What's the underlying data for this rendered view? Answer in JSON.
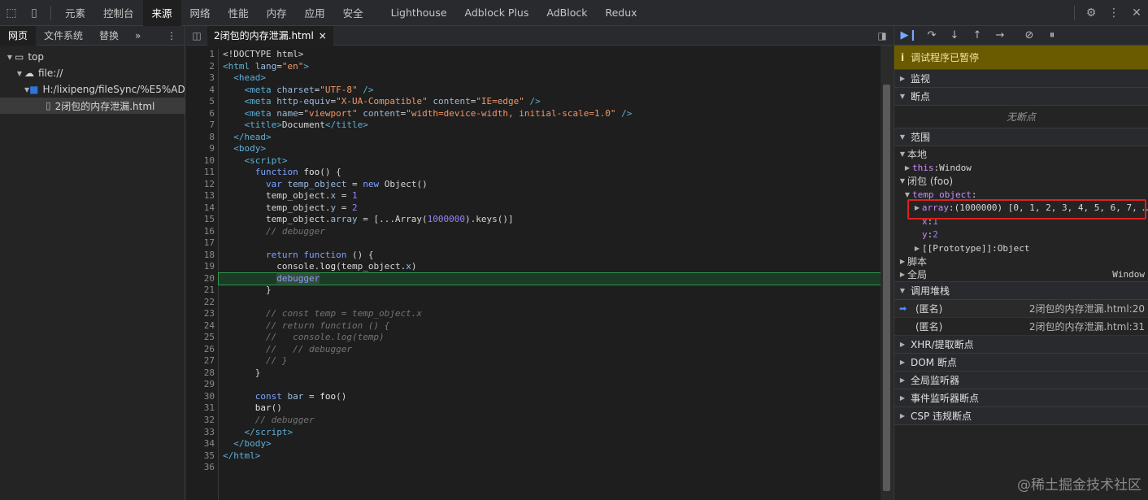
{
  "topbar": {
    "tabs": [
      "元素",
      "控制台",
      "来源",
      "网络",
      "性能",
      "内存",
      "应用",
      "安全",
      "Lighthouse",
      "Adblock Plus",
      "AdBlock",
      "Redux"
    ],
    "active_tab": "来源"
  },
  "navigator": {
    "tabs": [
      "网页",
      "文件系统",
      "替换",
      "»"
    ],
    "tree": {
      "top": "top",
      "origin": "file://",
      "folder": "H:/lixipeng/fileSync/%E5%AD%",
      "file": "2闭包的内存泄漏.html"
    }
  },
  "editor": {
    "file_tab": "2闭包的内存泄漏.html",
    "close_glyph": "×",
    "execution_line": 20,
    "line_count": 36
  },
  "debugger": {
    "paused_text": "调试程序已暂停",
    "sections": {
      "watch": "监视",
      "breakpoints": "断点",
      "no_breakpoints": "无断点",
      "scope": "范围",
      "local": "本地",
      "closure": "闭包 (foo)",
      "script": "脚本",
      "global": "全局",
      "global_value": "Window",
      "call_stack": "调用堆栈",
      "xhr": "XHR/提取断点",
      "dom": "DOM 断点",
      "global_listeners": "全局监听器",
      "event_listeners": "事件监听器断点",
      "csp": "CSP 违规断点"
    },
    "scope_items": {
      "this_key": "this",
      "this_val": "Window",
      "temp_object": "temp_object",
      "array_key": "array",
      "array_val": "(1000000) [0, 1, 2, 3, 4, 5, 6, 7, …",
      "x_key": "x",
      "x_val": "1",
      "y_key": "y",
      "y_val": "2",
      "proto_key": "[[Prototype]]",
      "proto_val": "Object"
    },
    "call_stack": [
      {
        "name": "(匿名)",
        "location": "2闭包的内存泄漏.html:20"
      },
      {
        "name": "(匿名)",
        "location": "2闭包的内存泄漏.html:31"
      }
    ]
  },
  "watermark": "@稀土掘金技术社区",
  "colors": {
    "paused_bg": "#6a5a00",
    "exec_line": "#1d3a26",
    "highlight": "#e0201a"
  }
}
